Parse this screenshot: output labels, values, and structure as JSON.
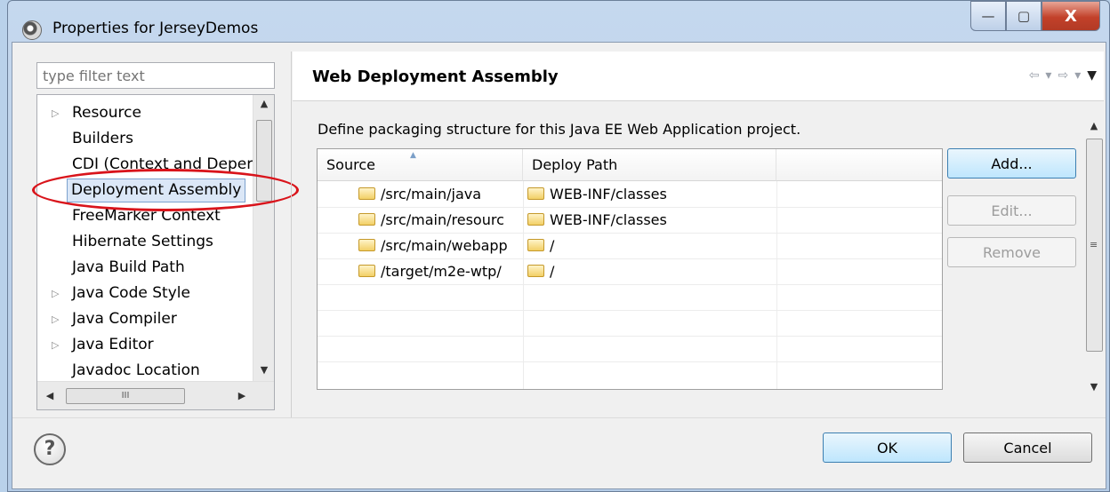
{
  "window": {
    "title": "Properties for JerseyDemos",
    "controls": {
      "minimize": "—",
      "maximize": "▢",
      "close": "X"
    }
  },
  "filter": {
    "placeholder": "type filter text"
  },
  "tree": {
    "items": [
      {
        "label": "Resource",
        "expandable": true
      },
      {
        "label": "Builders",
        "expandable": false
      },
      {
        "label": "CDI (Context and Deper",
        "expandable": false
      },
      {
        "label": "Deployment Assembly",
        "expandable": false,
        "selected": true
      },
      {
        "label": "FreeMarker Context",
        "expandable": false
      },
      {
        "label": "Hibernate Settings",
        "expandable": false
      },
      {
        "label": "Java Build Path",
        "expandable": false
      },
      {
        "label": "Java Code Style",
        "expandable": true
      },
      {
        "label": "Java Compiler",
        "expandable": true
      },
      {
        "label": "Java Editor",
        "expandable": true
      },
      {
        "label": "Javadoc Location",
        "expandable": false
      }
    ],
    "hscroll_grip": "III"
  },
  "page": {
    "title": "Web Deployment Assembly",
    "description": "Define packaging structure for this Java EE Web Application project.",
    "nav": {
      "back": "⇦",
      "forward": "⇨",
      "dropdown": "▾",
      "menu": "▼"
    }
  },
  "table": {
    "headers": [
      "Source",
      "Deploy Path"
    ],
    "rows": [
      {
        "source": "/src/main/java",
        "deploy": "WEB-INF/classes"
      },
      {
        "source": "/src/main/resourc",
        "deploy": "WEB-INF/classes"
      },
      {
        "source": "/src/main/webapp",
        "deploy": "/"
      },
      {
        "source": "/target/m2e-wtp/",
        "deploy": "/"
      }
    ]
  },
  "buttons": {
    "add": "Add...",
    "edit": "Edit...",
    "remove": "Remove",
    "ok": "OK",
    "cancel": "Cancel"
  },
  "help": {
    "glyph": "?"
  },
  "colors": {
    "annotation": "#d9141b",
    "selection": "#dbe7f7",
    "default_button": "#bee6fd"
  }
}
